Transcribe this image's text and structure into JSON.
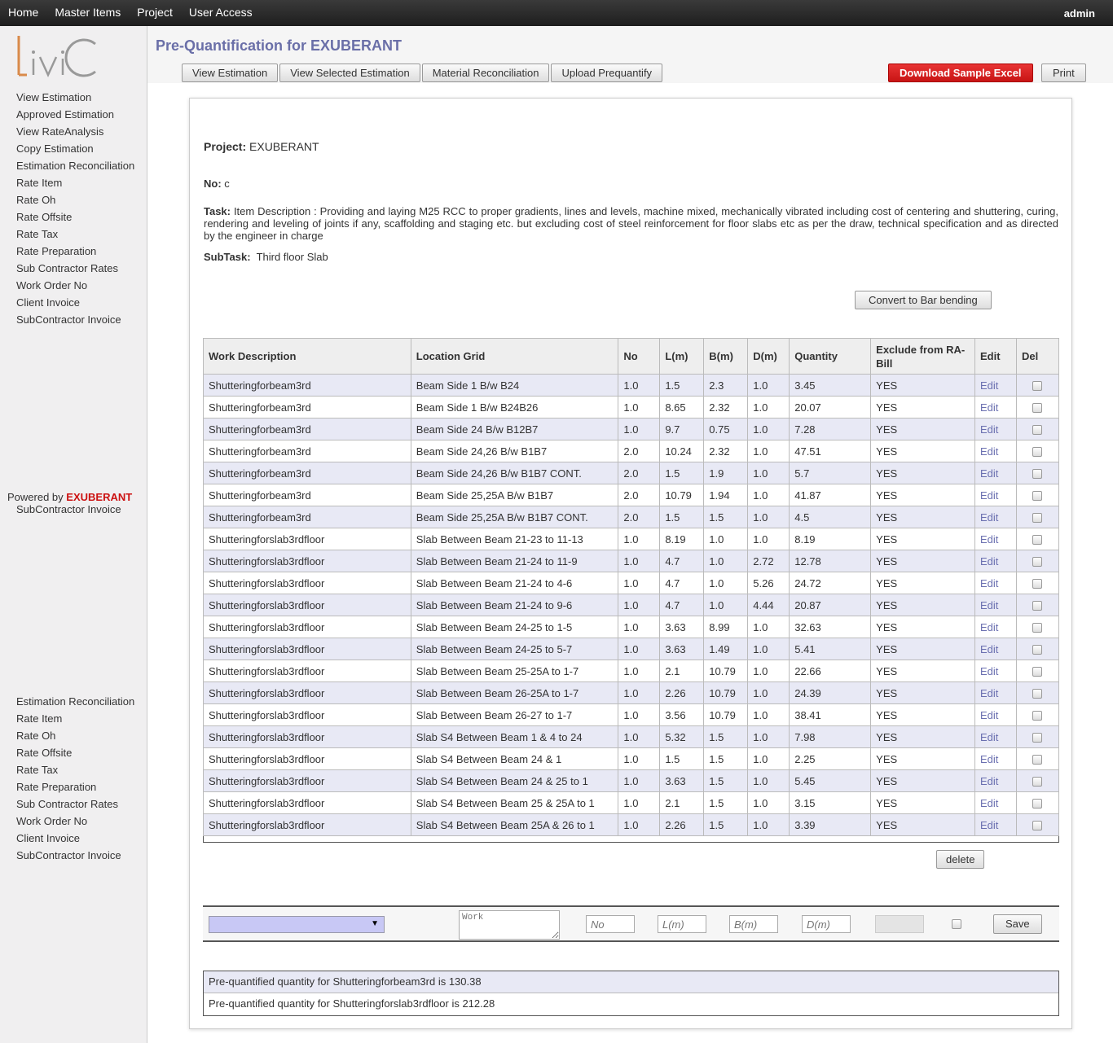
{
  "nav": {
    "items": [
      "Home",
      "Master Items",
      "Project",
      "User Access"
    ],
    "user": "admin"
  },
  "sidebar": {
    "logo_text": "LiviC",
    "items": [
      "View Estimation",
      "Approved Estimation",
      "View RateAnalysis",
      "Copy Estimation",
      "Estimation Reconciliation",
      "Rate Item",
      "Rate Oh",
      "Rate Offsite",
      "Rate Tax",
      "Rate Preparation",
      "Sub Contractor Rates",
      "Work Order No",
      "Client Invoice",
      "SubContractor Invoice"
    ],
    "powered_by_label": "Powered by",
    "powered_by_brand": "EXUBERANT",
    "overlap_item": "SubContractor Invoice",
    "items_repeat": [
      "Estimation Reconciliation",
      "Rate Item",
      "Rate Oh",
      "Rate Offsite",
      "Rate Tax",
      "Rate Preparation",
      "Sub Contractor Rates",
      "Work Order No",
      "Client Invoice",
      "SubContractor Invoice"
    ]
  },
  "header": {
    "title": "Pre-Quantification for EXUBERANT",
    "tabs": [
      "View Estimation",
      "View Selected Estimation",
      "Material Reconciliation",
      "Upload Prequantify"
    ],
    "download_label": "Download Sample Excel",
    "print_label": "Print"
  },
  "details": {
    "project_label": "Project:",
    "project_value": "EXUBERANT",
    "no_label": "No:",
    "no_value": "c",
    "task_label": "Task:",
    "task_value": "Item Description : Providing and laying M25 RCC to proper gradients, lines and levels, machine mixed, mechanically vibrated including cost of centering and shuttering, curing, rendering and leveling of joints if any, scaffolding and staging etc. but excluding cost of steel reinforcement for floor slabs etc as per the draw, technical specification and as directed by the engineer in charge",
    "subtask_label": "SubTask:",
    "subtask_value": "Third floor Slab",
    "convert_label": "Convert to Bar bending"
  },
  "table": {
    "headers": [
      "Work Description",
      "Location Grid",
      "No",
      "L(m)",
      "B(m)",
      "D(m)",
      "Quantity",
      "Exclude from RA-Bill",
      "Edit",
      "Del"
    ],
    "edit_label": "Edit",
    "rows": [
      [
        "Shutteringforbeam3rd",
        "Beam Side 1 B/w B24",
        "1.0",
        "1.5",
        "2.3",
        "1.0",
        "3.45",
        "YES"
      ],
      [
        "Shutteringforbeam3rd",
        "Beam Side 1 B/w B24B26",
        "1.0",
        "8.65",
        "2.32",
        "1.0",
        "20.07",
        "YES"
      ],
      [
        "Shutteringforbeam3rd",
        "Beam Side 24 B/w B12B7",
        "1.0",
        "9.7",
        "0.75",
        "1.0",
        "7.28",
        "YES"
      ],
      [
        "Shutteringforbeam3rd",
        "Beam Side 24,26 B/w B1B7",
        "2.0",
        "10.24",
        "2.32",
        "1.0",
        "47.51",
        "YES"
      ],
      [
        "Shutteringforbeam3rd",
        "Beam Side 24,26 B/w B1B7 CONT.",
        "2.0",
        "1.5",
        "1.9",
        "1.0",
        "5.7",
        "YES"
      ],
      [
        "Shutteringforbeam3rd",
        "Beam Side 25,25A B/w B1B7",
        "2.0",
        "10.79",
        "1.94",
        "1.0",
        "41.87",
        "YES"
      ],
      [
        "Shutteringforbeam3rd",
        "Beam Side 25,25A B/w B1B7 CONT.",
        "2.0",
        "1.5",
        "1.5",
        "1.0",
        "4.5",
        "YES"
      ],
      [
        "Shutteringforslab3rdfloor",
        "Slab Between Beam 21-23 to 11-13",
        "1.0",
        "8.19",
        "1.0",
        "1.0",
        "8.19",
        "YES"
      ],
      [
        "Shutteringforslab3rdfloor",
        "Slab Between Beam 21-24 to 11-9",
        "1.0",
        "4.7",
        "1.0",
        "2.72",
        "12.78",
        "YES"
      ],
      [
        "Shutteringforslab3rdfloor",
        "Slab Between Beam 21-24 to 4-6",
        "1.0",
        "4.7",
        "1.0",
        "5.26",
        "24.72",
        "YES"
      ],
      [
        "Shutteringforslab3rdfloor",
        "Slab Between Beam 21-24 to 9-6",
        "1.0",
        "4.7",
        "1.0",
        "4.44",
        "20.87",
        "YES"
      ],
      [
        "Shutteringforslab3rdfloor",
        "Slab Between Beam 24-25 to 1-5",
        "1.0",
        "3.63",
        "8.99",
        "1.0",
        "32.63",
        "YES"
      ],
      [
        "Shutteringforslab3rdfloor",
        "Slab Between Beam 24-25 to 5-7",
        "1.0",
        "3.63",
        "1.49",
        "1.0",
        "5.41",
        "YES"
      ],
      [
        "Shutteringforslab3rdfloor",
        "Slab Between Beam 25-25A to 1-7",
        "1.0",
        "2.1",
        "10.79",
        "1.0",
        "22.66",
        "YES"
      ],
      [
        "Shutteringforslab3rdfloor",
        "Slab Between Beam 26-25A to 1-7",
        "1.0",
        "2.26",
        "10.79",
        "1.0",
        "24.39",
        "YES"
      ],
      [
        "Shutteringforslab3rdfloor",
        "Slab Between Beam 26-27 to 1-7",
        "1.0",
        "3.56",
        "10.79",
        "1.0",
        "38.41",
        "YES"
      ],
      [
        "Shutteringforslab3rdfloor",
        "Slab S4 Between Beam 1 & 4 to 24",
        "1.0",
        "5.32",
        "1.5",
        "1.0",
        "7.98",
        "YES"
      ],
      [
        "Shutteringforslab3rdfloor",
        "Slab S4 Between Beam 24 & 1",
        "1.0",
        "1.5",
        "1.5",
        "1.0",
        "2.25",
        "YES"
      ],
      [
        "Shutteringforslab3rdfloor",
        "Slab S4 Between Beam 24 & 25 to 1",
        "1.0",
        "3.63",
        "1.5",
        "1.0",
        "5.45",
        "YES"
      ],
      [
        "Shutteringforslab3rdfloor",
        "Slab S4 Between Beam 25 & 25A to 1",
        "1.0",
        "2.1",
        "1.5",
        "1.0",
        "3.15",
        "YES"
      ],
      [
        "Shutteringforslab3rdfloor",
        "Slab S4 Between Beam 25A & 26 to 1",
        "1.0",
        "2.26",
        "1.5",
        "1.0",
        "3.39",
        "YES"
      ]
    ],
    "delete_label": "delete"
  },
  "entry": {
    "select_value": "",
    "work_placeholder": "Work",
    "no_placeholder": "No",
    "l_placeholder": "L(m)",
    "b_placeholder": "B(m)",
    "d_placeholder": "D(m)",
    "save_label": "Save"
  },
  "summary": [
    "Pre-quantified quantity for Shutteringforbeam3rd is 130.38",
    "Pre-quantified quantity for Shutteringforslab3rdfloor is 212.28"
  ],
  "colors": {
    "title": "#6a6fa8",
    "download_button": "#d42020",
    "brand_red": "#cc1111",
    "row_stripe": "#e8e9f5",
    "edit_link": "#6a6fb0"
  }
}
